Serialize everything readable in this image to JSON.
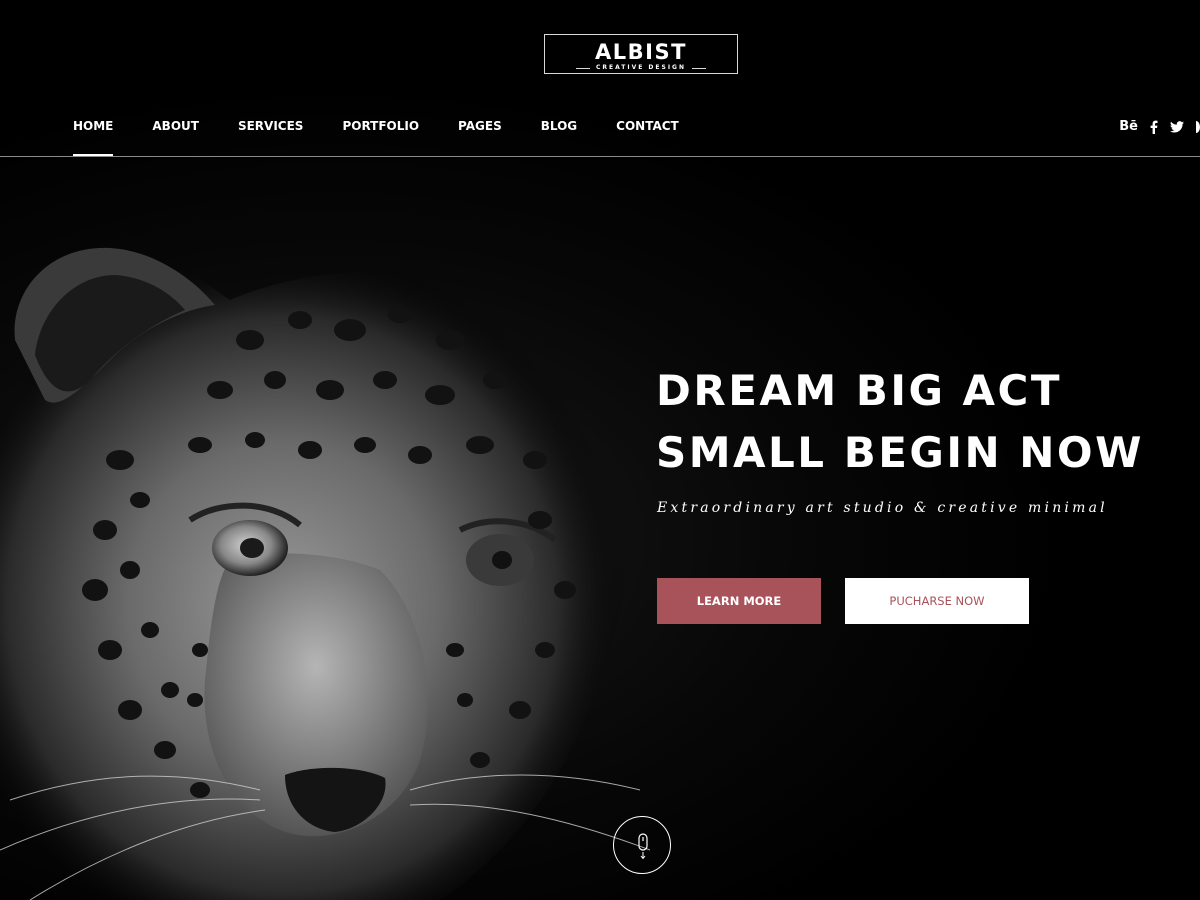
{
  "logo": {
    "title": "ALBIST",
    "subtitle": "CREATIVE DESIGN"
  },
  "nav": {
    "items": [
      {
        "label": "HOME",
        "active": true
      },
      {
        "label": "ABOUT",
        "active": false
      },
      {
        "label": "SERVICES",
        "active": false
      },
      {
        "label": "PORTFOLIO",
        "active": false
      },
      {
        "label": "PAGES",
        "active": false
      },
      {
        "label": "BLOG",
        "active": false
      },
      {
        "label": "CONTACT",
        "active": false
      }
    ]
  },
  "social": {
    "behance_label": "Bē",
    "icons": [
      "behance-icon",
      "facebook-icon",
      "twitter-icon",
      "more-icon"
    ]
  },
  "hero": {
    "title_line1": "DREAM BIG ACT",
    "title_line2": "SMALL BEGIN NOW",
    "subtitle": "Extraordinary art studio & creative minimal",
    "learn_more": "LEARN MORE",
    "purchase": "PUCHARSE NOW"
  },
  "colors": {
    "accent": "#a8525a",
    "background": "#000000",
    "text": "#ffffff"
  }
}
